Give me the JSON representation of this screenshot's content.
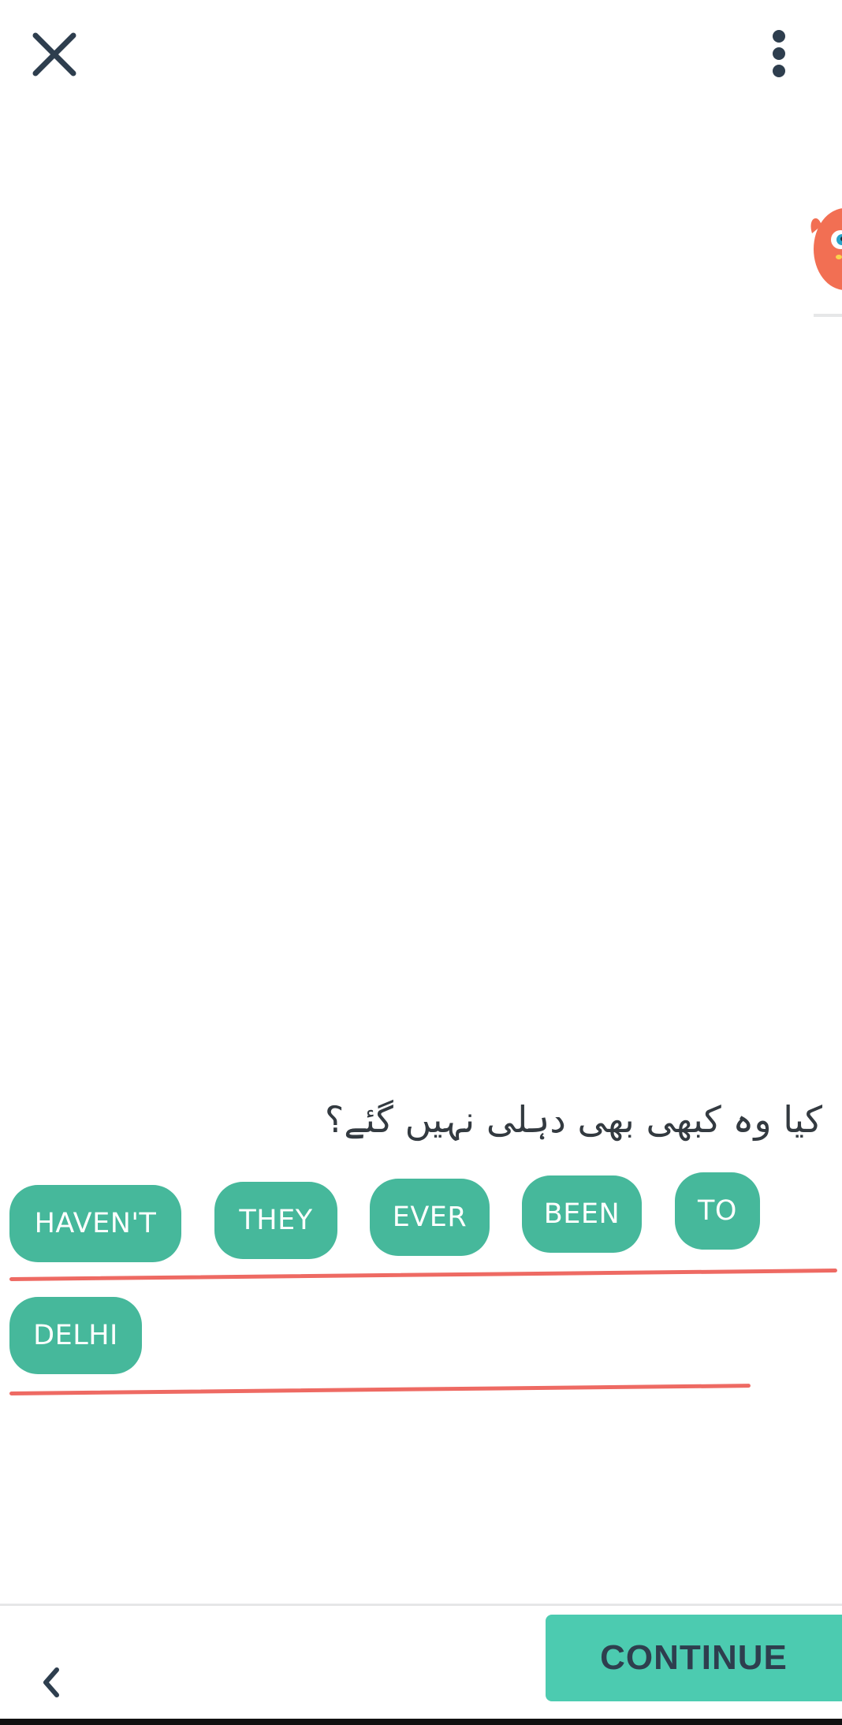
{
  "header": {
    "close_icon": "close-icon",
    "more_icon": "more-vertical-icon"
  },
  "prompt": {
    "text": "کیا وہ کبھی بھی دہلی نہیں گئے؟"
  },
  "answer_chips": [
    {
      "label": "HAVEN'T"
    },
    {
      "label": "THEY"
    },
    {
      "label": "EVER"
    },
    {
      "label": "BEEN"
    },
    {
      "label": "TO"
    },
    {
      "label": "DELHI"
    }
  ],
  "footer": {
    "back_icon": "chevron-left-icon",
    "continue_label": "CONTINUE"
  },
  "colors": {
    "chip": "#46b89b",
    "continue": "#4ccbb0",
    "underline": "#ee6a63",
    "icon": "#2e3e4e",
    "mascot": "#f26f53"
  }
}
